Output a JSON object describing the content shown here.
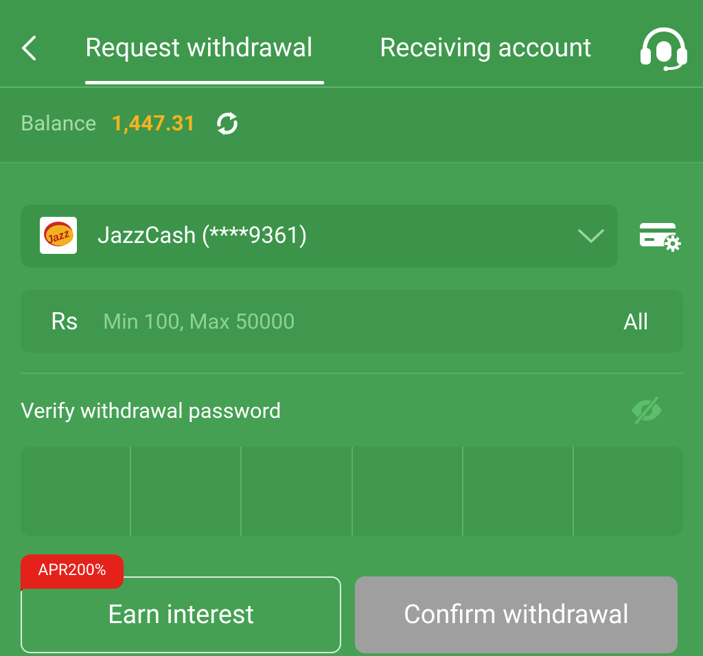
{
  "header": {
    "back_icon": "chevron-left-icon",
    "tabs": [
      {
        "label": "Request withdrawal",
        "active": true
      },
      {
        "label": "Receiving account",
        "active": false
      }
    ],
    "support_icon": "headset-icon"
  },
  "balance": {
    "label": "Balance",
    "value": "1,447.31",
    "value_color": "#f7b21f",
    "refresh_icon": "refresh-icon"
  },
  "account": {
    "logo_icon": "jazzcash-logo",
    "label": "JazzCash (****9361)",
    "dropdown_icon": "chevron-down-icon",
    "settings_icon": "card-settings-icon"
  },
  "amount": {
    "currency": "Rs",
    "placeholder": "Min 100, Max 50000",
    "value": "",
    "all_label": "All"
  },
  "password": {
    "label": "Verify withdrawal password",
    "visibility_icon": "eye-off-icon",
    "digits": 6
  },
  "actions": {
    "badge": "APR200%",
    "badge_color": "#e5211b",
    "earn_label": "Earn interest",
    "confirm_label": "Confirm withdrawal",
    "confirm_color": "#9f9f9f"
  },
  "colors": {
    "background": "#45a054",
    "header": "#3e994d"
  }
}
